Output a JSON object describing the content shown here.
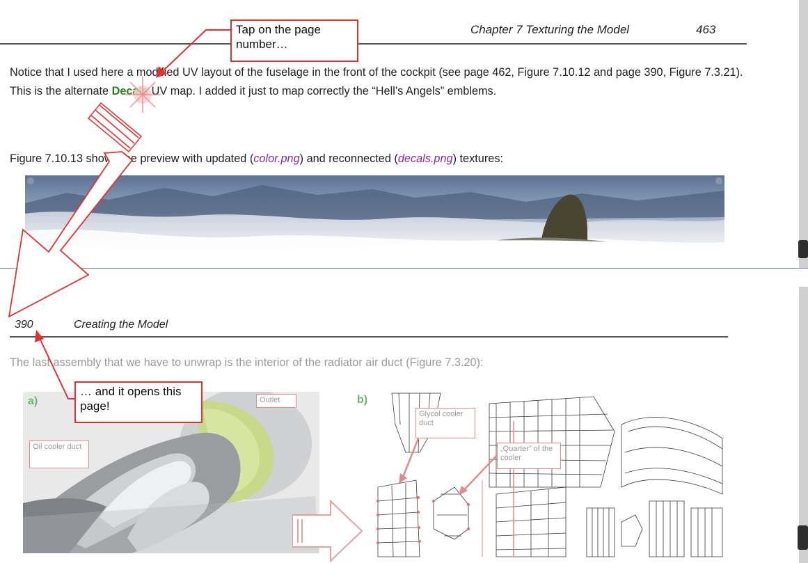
{
  "header_top": {
    "chapter": "Chapter 7 Texturing the Model",
    "page": "463"
  },
  "paragraph1": {
    "part1": "Notice that I used here a modified UV layout of the fuselage in the front of the cockpit (see page 462, Figure 7.10.12 and page 390, Figure 7.3.21). This is the alternate ",
    "decals": "Decals",
    "part2": " UV map. I added it just to map correctly the “Hell’s Angels” emblems."
  },
  "paragraph2": {
    "part1": "Figure 7.10.13 shows the preview with updated (",
    "color_file": "color.png",
    "part2": ") and reconnected (",
    "decals_file": "decals.png",
    "part3": ") textures:"
  },
  "header_bottom": {
    "page": "390",
    "title": "Creating the Model"
  },
  "paragraph3": "The last assembly that we have to unwrap is the interior of the radiator air duct (Figure 7.3.20):",
  "callouts": {
    "tap": "Tap on the page number…",
    "opens": "… and it opens this page!"
  },
  "figure": {
    "label_a": "a)",
    "label_b": "b)",
    "outlet": "Outlet",
    "oil_cooler": "Oil cooler duct",
    "glycol": "Glycol cooler duct",
    "quarter": "„Quarter” of the cooler"
  },
  "colors": {
    "accent_red": "#e53030",
    "decals_green": "#2e7d1f",
    "file_purple": "#8c2aa8",
    "divider_blue": "#6a97c9"
  }
}
